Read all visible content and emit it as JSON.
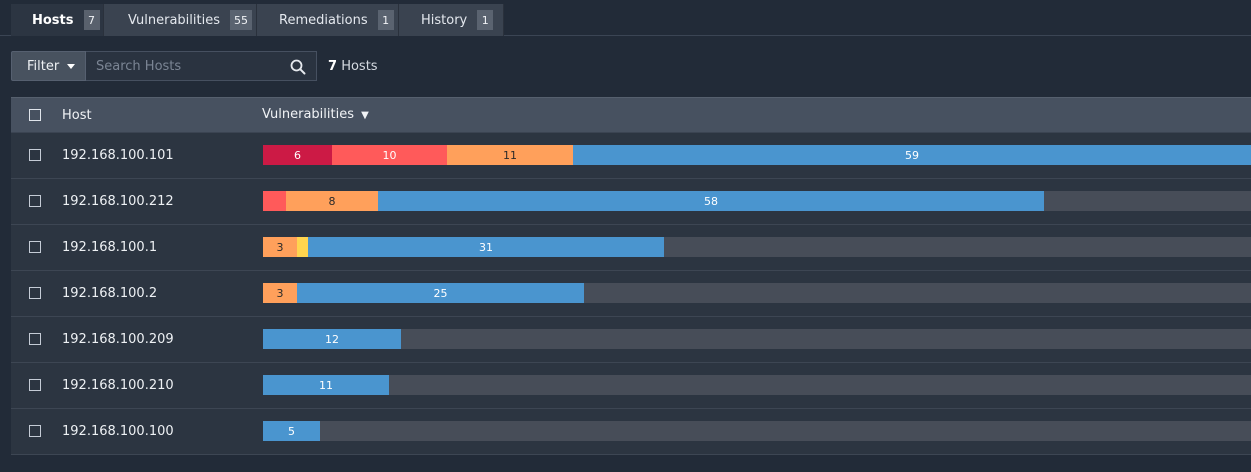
{
  "colors": {
    "critical": "#cc1a45",
    "high": "#ff5a5a",
    "medium": "#ffa05b",
    "low": "#ffd54f",
    "info": "#4a95cf",
    "track": "#474d58"
  },
  "tabs": [
    {
      "label": "Hosts",
      "count": "7",
      "active": true
    },
    {
      "label": "Vulnerabilities",
      "count": "55",
      "active": false
    },
    {
      "label": "Remediations",
      "count": "1",
      "active": false
    },
    {
      "label": "History",
      "count": "1",
      "active": false
    }
  ],
  "toolbar": {
    "filter_label": "Filter",
    "search_placeholder": "Search Hosts",
    "search_value": "",
    "count_number": "7",
    "count_label": "Hosts"
  },
  "table": {
    "columns": {
      "host": "Host",
      "vulnerabilities": "Vulnerabilities"
    },
    "sort_indicator": "▼",
    "rows": [
      {
        "host": "192.168.100.101",
        "segments": [
          {
            "severity": "critical",
            "value": 6,
            "label": "6"
          },
          {
            "severity": "high",
            "value": 10,
            "label": "10"
          },
          {
            "severity": "medium",
            "value": 11,
            "label": "11"
          },
          {
            "severity": "info",
            "value": 59,
            "label": "59"
          }
        ]
      },
      {
        "host": "192.168.100.212",
        "segments": [
          {
            "severity": "high",
            "value": 2,
            "label": ""
          },
          {
            "severity": "medium",
            "value": 8,
            "label": "8"
          },
          {
            "severity": "info",
            "value": 58,
            "label": "58"
          }
        ]
      },
      {
        "host": "192.168.100.1",
        "segments": [
          {
            "severity": "medium",
            "value": 3,
            "label": "3"
          },
          {
            "severity": "low",
            "value": 1,
            "label": ""
          },
          {
            "severity": "info",
            "value": 31,
            "label": "31"
          }
        ]
      },
      {
        "host": "192.168.100.2",
        "segments": [
          {
            "severity": "medium",
            "value": 3,
            "label": "3"
          },
          {
            "severity": "info",
            "value": 25,
            "label": "25"
          }
        ]
      },
      {
        "host": "192.168.100.209",
        "segments": [
          {
            "severity": "info",
            "value": 12,
            "label": "12"
          }
        ]
      },
      {
        "host": "192.168.100.210",
        "segments": [
          {
            "severity": "info",
            "value": 11,
            "label": "11"
          }
        ]
      },
      {
        "host": "192.168.100.100",
        "segments": [
          {
            "severity": "info",
            "value": 5,
            "label": "5"
          }
        ]
      }
    ]
  }
}
